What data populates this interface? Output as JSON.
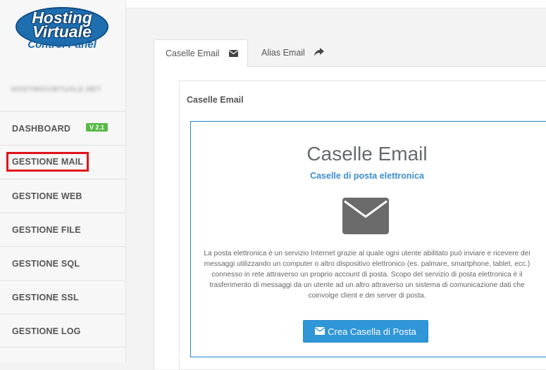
{
  "logo": {
    "line1": "Hosting",
    "line2": "Virtuale",
    "line3": "Control Panel"
  },
  "sidebar": {
    "domain": "HOSTINGVIRTUALE.NET",
    "items": [
      {
        "label": "DASHBOARD",
        "badge": "V 2.1"
      },
      {
        "label": "GESTIONE MAIL"
      },
      {
        "label": "GESTIONE WEB"
      },
      {
        "label": "GESTIONE FILE"
      },
      {
        "label": "GESTIONE SQL"
      },
      {
        "label": "GESTIONE SSL"
      },
      {
        "label": "GESTIONE LOG"
      }
    ]
  },
  "tabs": [
    {
      "label": "Caselle Email",
      "icon": "envelope-icon"
    },
    {
      "label": "Alias Email",
      "icon": "share-arrow-icon"
    }
  ],
  "panel": {
    "title": "Caselle Email",
    "hero_title": "Caselle Email",
    "hero_subtitle": "Caselle di posta elettronica",
    "description": "La posta elettronica è un servizio Internet grazie al quale ogni utente abilitato può inviare e ricevere dei messaggi utilizzando un computer o altro dispositivo elettronico (es. palmare, smartphone, tablet, ecc.) connesso in rete attraverso un proprio account di posta. Scopo del servizio di posta elettronica è il trasferimento di messaggi da un utente ad un altro attraverso un sistema di comunicazione dati che coinvolge client e dei server di posta.",
    "button_label": "Crea Casella di Posta"
  },
  "colors": {
    "accent": "#2f96d8",
    "highlight": "#e0141b",
    "badge": "#58b947",
    "hero_border": "#1d87c7"
  }
}
